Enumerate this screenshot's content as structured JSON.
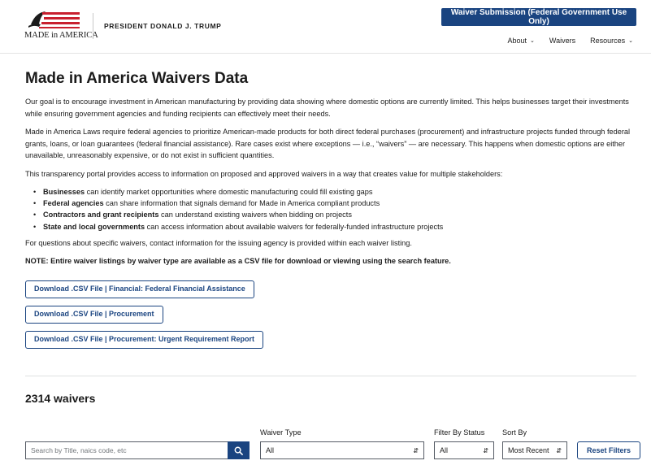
{
  "header": {
    "logo_text": "MADE in AMERICA",
    "president": "PRESIDENT DONALD J. TRUMP",
    "waiver_submission": "Waiver Submission (Federal Government Use Only)",
    "nav": [
      {
        "label": "About"
      },
      {
        "label": "Waivers"
      },
      {
        "label": "Resources"
      }
    ]
  },
  "main": {
    "title": "Made in America Waivers Data",
    "p1": "Our goal is to encourage investment in American manufacturing by providing data showing where domestic options are currently limited. This helps businesses target their investments while ensuring government agencies and funding recipients can effectively meet their needs.",
    "p2": "Made in America Laws require federal agencies to prioritize American-made products for both direct federal purchases (procurement) and infrastructure projects funded through federal grants, loans, or loan guarantees (federal financial assistance). Rare cases exist where exceptions — i.e., “waivers” — are necessary. This happens when domestic options are either unavailable, unreasonably expensive, or do not exist in sufficient quantities.",
    "p3": "This transparency portal provides access to information on proposed and approved waivers in a way that creates value for multiple stakeholders:",
    "bullets": [
      {
        "bold": "Businesses",
        "rest": " can identify market opportunities where domestic manufacturing could fill existing gaps"
      },
      {
        "bold": "Federal agencies",
        "rest": " can share information that signals demand for Made in America compliant products"
      },
      {
        "bold": "Contractors and grant recipients",
        "rest": " can understand existing waivers when bidding on projects"
      },
      {
        "bold": "State and local governments",
        "rest": " can access information about available waivers for federally-funded infrastructure projects"
      }
    ],
    "p4": "For questions about specific waivers, contact information for the issuing agency is provided within each waiver listing.",
    "note": "NOTE: Entire waiver listings by waiver type are available as a CSV file for download or viewing using the search feature.",
    "downloads": [
      "Download .CSV File | Financial: Federal Financial Assistance",
      "Download .CSV File | Procurement",
      "Download .CSV File | Procurement: Urgent Requirement Report"
    ],
    "count": "2314 waivers"
  },
  "filters": {
    "search_placeholder": "Search by Title, naics code, etc",
    "waiver_type_label": "Waiver Type",
    "waiver_type_value": "All",
    "status_label": "Filter By Status",
    "status_value": "All",
    "sort_label": "Sort By",
    "sort_value": "Most Recent",
    "reset": "Reset Filters"
  },
  "colors": {
    "primary": "#1a4480",
    "logo_red": "#c8202f"
  }
}
